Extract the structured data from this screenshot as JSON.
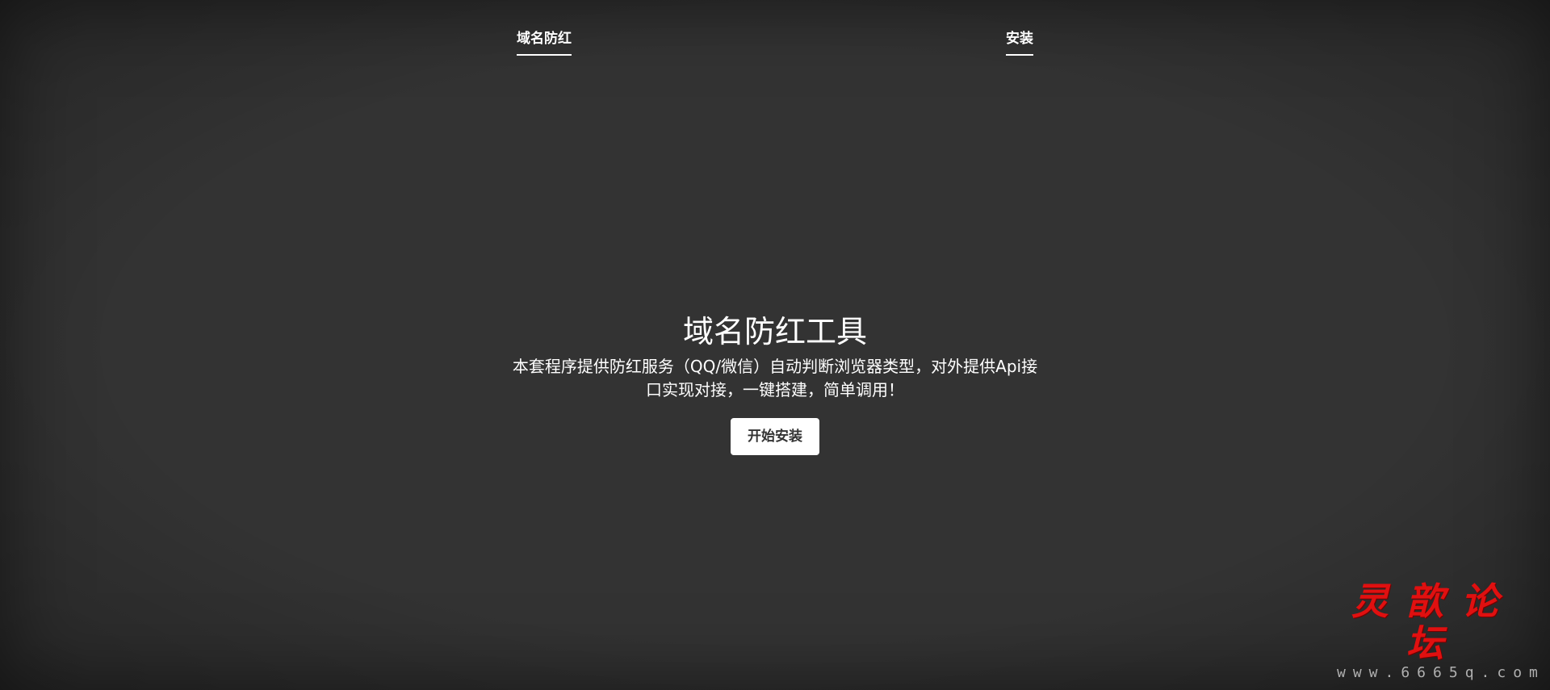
{
  "header": {
    "brand": "域名防红",
    "nav": [
      {
        "label": "安装"
      }
    ]
  },
  "cover": {
    "heading": "域名防红工具",
    "lead": "本套程序提供防红服务（QQ/微信）自动判断浏览器类型，对外提供Api接口实现对接，一键搭建，简单调用！",
    "button_label": "开始安装"
  },
  "watermark": {
    "title": "灵歆论坛",
    "url": "www.6665q.com",
    "color": "#e01010"
  }
}
